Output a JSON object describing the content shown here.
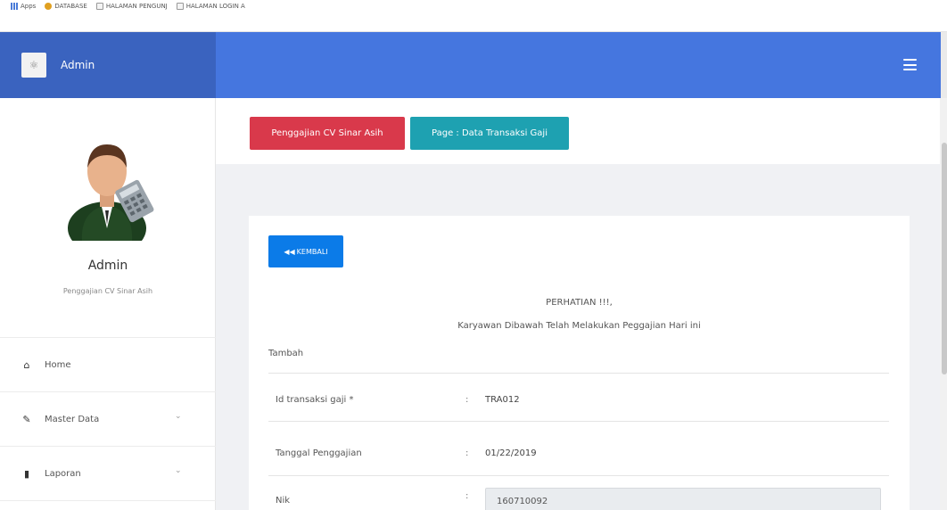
{
  "bookmarks": [
    {
      "label": "Apps",
      "icon": "apps-grid-icon"
    },
    {
      "label": "DATABASE",
      "icon": "database-icon"
    },
    {
      "label": "HALAMAN PENGUNJ",
      "icon": "page-icon"
    },
    {
      "label": "HALAMAN LOGIN A",
      "icon": "page-icon"
    }
  ],
  "brand": {
    "name": "Admin"
  },
  "sidebar": {
    "user_name": "Admin",
    "user_role": "Penggajian CV Sinar Asih",
    "items": [
      {
        "label": "Home",
        "icon": "home-icon"
      },
      {
        "label": "Master Data",
        "icon": "edit-icon",
        "expandable": true
      },
      {
        "label": "Laporan",
        "icon": "book-icon",
        "expandable": true
      }
    ]
  },
  "breadcrumb": {
    "app": "Penggajian CV Sinar Asih",
    "page": "Page : Data Transaksi Gaji"
  },
  "main": {
    "back_button": "KEMBALI",
    "notice_title": "PERHATIAN !!!,",
    "notice_text": "Karyawan Dibawah Telah Melakukan Peggajian Hari ini",
    "section_title": "Tambah",
    "fields": [
      {
        "label": "Id transaksi gaji *",
        "value": "TRA012"
      },
      {
        "label": "Tanggal Penggajian",
        "value": "01/22/2019"
      },
      {
        "label": "Nik",
        "value": "160710092"
      }
    ]
  },
  "colors": {
    "navbar": "#4576df",
    "brand_bg": "#3a63bf",
    "crumb_red": "#d9394b",
    "crumb_teal": "#1ea1b1",
    "button_blue": "#0b7be8"
  }
}
